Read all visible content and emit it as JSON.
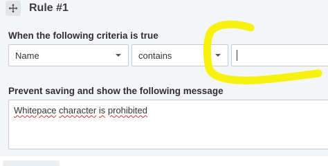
{
  "rule": {
    "title": "Rule #1",
    "move_icon": "move-arrows-icon"
  },
  "criteria": {
    "label": "When the following criteria is true",
    "field": {
      "value": "Name",
      "options_visible": [
        "Name"
      ]
    },
    "operator": {
      "value": "contains",
      "options_visible": [
        "contains"
      ]
    },
    "value_input": {
      "value": "",
      "placeholder": ""
    }
  },
  "message": {
    "label": "Prevent saving and show the following message",
    "words": [
      "Whitepace",
      "character",
      "is",
      "prohibited"
    ],
    "text": "Whitepace character is prohibited"
  },
  "annotation": {
    "color": "#f5f000",
    "shape": "hand-drawn bracket"
  }
}
